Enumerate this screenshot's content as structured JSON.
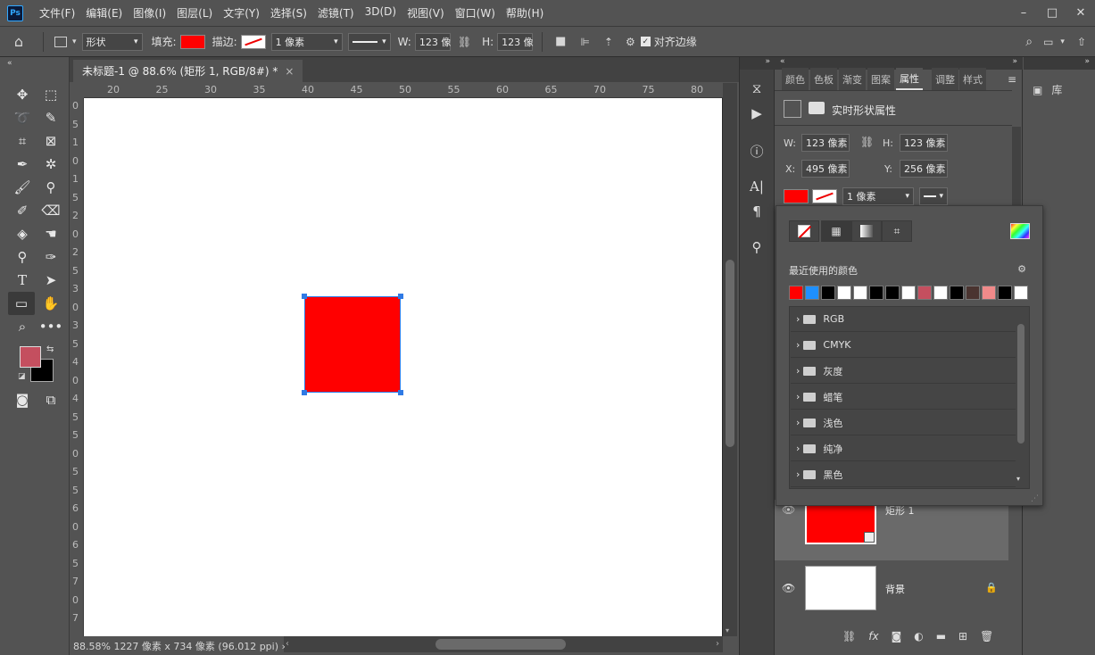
{
  "menubar": {
    "items": [
      "文件(F)",
      "编辑(E)",
      "图像(I)",
      "图层(L)",
      "文字(Y)",
      "选择(S)",
      "滤镜(T)",
      "3D(D)",
      "视图(V)",
      "窗口(W)",
      "帮助(H)"
    ],
    "logo": "Ps"
  },
  "options": {
    "mode": "形状",
    "fill_label": "填充:",
    "fill_color": "#ff0000",
    "stroke_label": "描边:",
    "stroke_width": "1 像素",
    "w_label": "W:",
    "w_value": "123 像",
    "h_label": "H:",
    "h_value": "123 像",
    "align_edges": "对齐边缘"
  },
  "document": {
    "tab_title": "未标题-1 @ 88.6% (矩形 1, RGB/8#) *",
    "tab_close": "×",
    "ruler_h": [
      "20",
      "25",
      "30",
      "35",
      "40",
      "45",
      "50",
      "55",
      "60",
      "65",
      "70",
      "75",
      "80"
    ],
    "ruler_v": [
      "0",
      "5",
      "1",
      "0",
      "1",
      "5",
      "2",
      "0",
      "2",
      "5",
      "3",
      "0",
      "3",
      "5",
      "4",
      "0",
      "4",
      "5",
      "5",
      "0",
      "5",
      "5",
      "6",
      "0",
      "6",
      "5",
      "7",
      "0",
      "7"
    ],
    "shape_color": "#ff0000",
    "status": "88.58%  1227 像素 x 734 像素 (96.012 ppi)  ›"
  },
  "colors": {
    "foreground": "#c44f5f",
    "background": "#000000"
  },
  "properties_panel": {
    "tabs": [
      "颜色",
      "色板",
      "渐变",
      "图案",
      "属性",
      "调整",
      "样式"
    ],
    "active_tab": "属性",
    "header": "实时形状属性",
    "w_label": "W:",
    "w_value": "123 像素",
    "h_label": "H:",
    "h_value": "123 像素",
    "x_label": "X:",
    "x_value": "495 像素",
    "y_label": "Y:",
    "y_value": "256 像素",
    "stroke_width": "1 像素"
  },
  "library": {
    "label": "库"
  },
  "fill_popup": {
    "recent_label": "最近使用的颜色",
    "recent_colors": [
      "#ff0000",
      "#1e90ff",
      "#000000",
      "#ffffff",
      "#ffffff",
      "#000000",
      "#000000",
      "#ffffff",
      "#c44f5f",
      "#ffffff",
      "#000000",
      "#4a3430",
      "#f08a8a",
      "#000000",
      "#ffffff"
    ],
    "folders": [
      "RGB",
      "CMYK",
      "灰度",
      "蜡笔",
      "浅色",
      "纯净",
      "黑色"
    ]
  },
  "layers": [
    {
      "name": "矩形 1",
      "thumb": "#ff0000"
    },
    {
      "name": "背景",
      "thumb": "#ffffff"
    }
  ]
}
